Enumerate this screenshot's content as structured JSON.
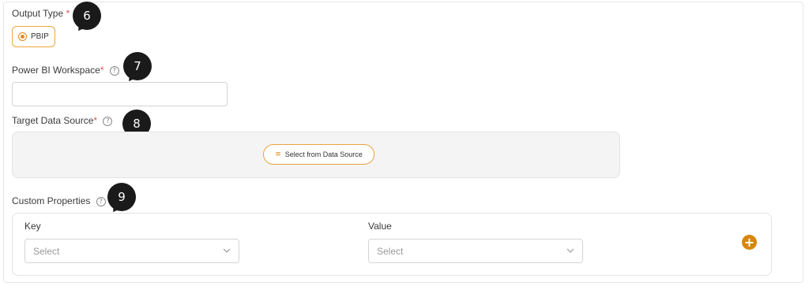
{
  "form": {
    "output_type": {
      "label": "Output Type",
      "required_mark": "*",
      "option": "PBIP"
    },
    "workspace": {
      "label": "Power BI Workspace",
      "required_mark": "*",
      "help_icon": "?",
      "value": ""
    },
    "target_data_source": {
      "label": "Target Data Source",
      "required_mark": "*",
      "help_icon": "?",
      "button_icon": "≡",
      "button_label": "Select from Data Source"
    },
    "custom_properties": {
      "label": "Custom Properties",
      "help_icon": "?",
      "key_label": "Key",
      "value_label": "Value",
      "key_placeholder": "Select",
      "value_placeholder": "Select",
      "add_icon": "+"
    }
  },
  "callouts": [
    "6",
    "7",
    "8",
    "9"
  ],
  "colors": {
    "accent": "#e8891a",
    "required": "#d9534f",
    "callout_bg": "#1a1a1a"
  }
}
